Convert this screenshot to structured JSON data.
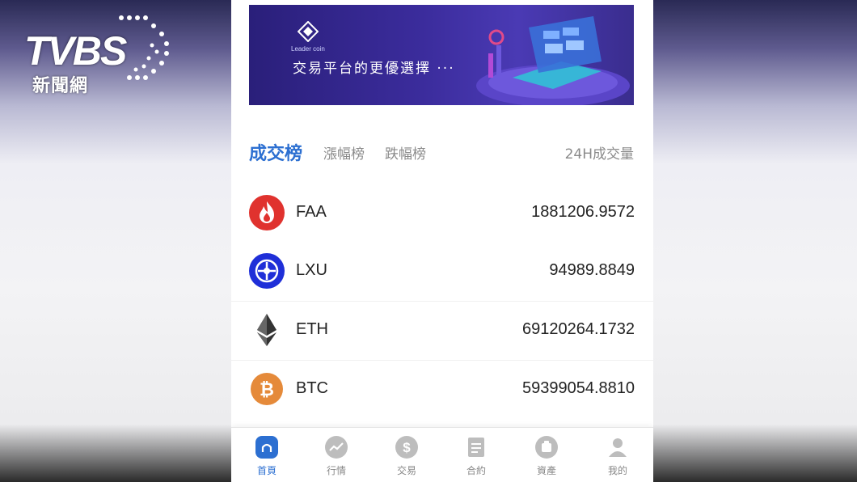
{
  "watermark": {
    "brand": "TVBS",
    "subtitle": "新聞網"
  },
  "banner": {
    "logo_text": "Leader coin",
    "tagline": "交易平台的更優選擇 ···"
  },
  "tabs": {
    "items": [
      {
        "label": "成交榜",
        "active": true
      },
      {
        "label": "漲幅榜",
        "active": false
      },
      {
        "label": "跌幅榜",
        "active": false
      }
    ],
    "right_label": "24H成交量"
  },
  "coins": [
    {
      "symbol": "FAA",
      "volume": "1881206.9572",
      "icon": "flame-icon",
      "color": "#e0322e"
    },
    {
      "symbol": "LXU",
      "volume": "94989.8849",
      "icon": "compass-icon",
      "color": "#1f2fd8"
    },
    {
      "symbol": "ETH",
      "volume": "69120264.1732",
      "icon": "ethereum-icon",
      "color": "#333333"
    },
    {
      "symbol": "BTC",
      "volume": "59399054.8810",
      "icon": "bitcoin-icon",
      "color": "#e58a3a"
    }
  ],
  "bottom_nav": [
    {
      "label": "首頁",
      "icon": "home-icon",
      "active": true
    },
    {
      "label": "行情",
      "icon": "chart-icon",
      "active": false
    },
    {
      "label": "交易",
      "icon": "dollar-icon",
      "active": false
    },
    {
      "label": "合約",
      "icon": "contract-icon",
      "active": false
    },
    {
      "label": "資產",
      "icon": "wallet-icon",
      "active": false
    },
    {
      "label": "我的",
      "icon": "user-icon",
      "active": false
    }
  ],
  "colors": {
    "accent": "#2c6fd1",
    "inactive": "#888888"
  }
}
